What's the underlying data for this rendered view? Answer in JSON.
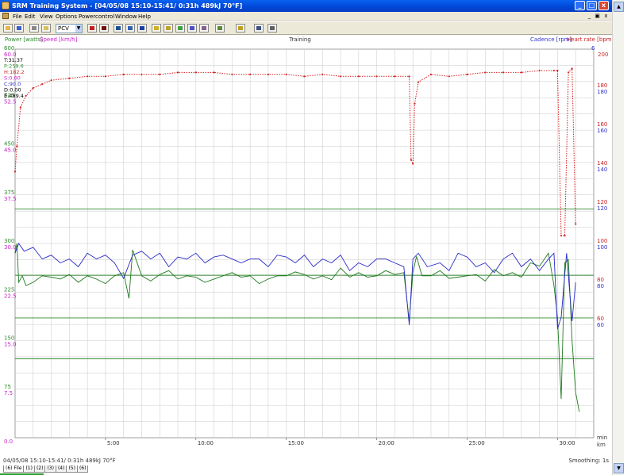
{
  "window": {
    "title": "SRM Training System - [04/05/08 15:10-15:41/ 0:31h 489kJ 70°F]",
    "minimize_label": "_",
    "maximize_label": "□",
    "close_label": "x",
    "mdi_minimize_label": "_",
    "mdi_restore_label": "▣",
    "mdi_close_label": "x"
  },
  "menu": {
    "items": [
      "File",
      "Edit",
      "View",
      "Options",
      "Powercontrol",
      "Window",
      "Help"
    ]
  },
  "toolbar": {
    "combo_value": "PCV",
    "tools": [
      "open-icon",
      "save-icon",
      "print-icon",
      "copy-icon",
      "marker-red-icon",
      "marker-dark-icon",
      "view-split-icon",
      "view-stack-icon",
      "view-panel-icon",
      "graph-icon",
      "graph-multi-icon",
      "graph-line-icon",
      "graph-bar-icon",
      "graph-blank-icon",
      "bar-chart-icon",
      "scatter-icon",
      "info-icon"
    ]
  },
  "chart": {
    "title": "Training",
    "left_legend": [
      "Power [watts]",
      "Speed [km/h]"
    ],
    "right_legend": [
      "Cadence [rpm]",
      "Heart rate [bpm]"
    ],
    "readout": [
      "T:31.37",
      "P:259.6",
      "H:182.2",
      "S:0.00",
      "C:90.0",
      "D:0.00",
      "E:489.4"
    ],
    "readout_colors": [
      "#000000",
      "#2d8b2d",
      "#cc2a2a",
      "#cc22cc",
      "#3333cc",
      "#000000",
      "#000000"
    ],
    "axis_top_left": [
      "600",
      "60.0"
    ],
    "axis_top_right": [
      "6",
      "200"
    ],
    "x_unit_labels": [
      "min",
      "km"
    ],
    "colors": {
      "power": "#1f7a1f",
      "speed": "#cc22cc",
      "cadence": "#2a2ac8",
      "heart_rate": "#d42020",
      "grid": "#c8c8c8",
      "ref_line": "#2d8b2d"
    }
  },
  "chart_data": {
    "type": "line",
    "title": "Training",
    "x": {
      "label": "min",
      "range": [
        0,
        32
      ],
      "ticks": [
        "5:00",
        "10:00",
        "15:00",
        "20:00",
        "25:00",
        "30:00"
      ],
      "tick_values": [
        5,
        10,
        15,
        20,
        25,
        30
      ]
    },
    "y_left_power": {
      "label": "Power [watts]",
      "range": [
        0,
        600
      ],
      "ticks": [
        "75",
        "150",
        "225",
        "300",
        "375",
        "450",
        "525"
      ],
      "tick_values": [
        75,
        150,
        225,
        300,
        375,
        450,
        525
      ]
    },
    "y_left_speed": {
      "label": "Speed [km/h]",
      "range": [
        0,
        60
      ],
      "ticks": [
        "0.0",
        "7.5",
        "15.0",
        "22.5",
        "30.0",
        "37.5",
        "45.0",
        "52.5"
      ],
      "tick_values": [
        0,
        7.5,
        15,
        22.5,
        30,
        37.5,
        45,
        52.5
      ]
    },
    "y_right_cadence": {
      "label": "Cadence [rpm]",
      "range": [
        0,
        200
      ],
      "ticks": [
        "60",
        "80",
        "100",
        "120",
        "140",
        "160",
        "180"
      ],
      "tick_values": [
        60,
        80,
        100,
        120,
        140,
        160,
        180
      ]
    },
    "y_right_hr": {
      "label": "Heart rate [bpm]",
      "range": [
        0,
        200
      ],
      "ticks": [
        "60",
        "80",
        "100",
        "120",
        "140",
        "160",
        "180"
      ],
      "tick_values": [
        60,
        80,
        100,
        120,
        140,
        160,
        180
      ]
    },
    "reference_lines_power": [
      353,
      251,
      185,
      122
    ],
    "series": [
      {
        "name": "Power [watts]",
        "axis": "power",
        "x": [
          0,
          0.1,
          0.2,
          0.4,
          0.6,
          1,
          1.5,
          2,
          2.5,
          3,
          3.5,
          4,
          4.5,
          5,
          5.5,
          6,
          6.3,
          6.5,
          7,
          7.5,
          8,
          8.5,
          9,
          9.5,
          10,
          10.5,
          11,
          11.5,
          12,
          12.5,
          13,
          13.5,
          14,
          14.5,
          15,
          15.5,
          16,
          16.5,
          17,
          17.5,
          18,
          18.5,
          19,
          19.5,
          20,
          20.5,
          21,
          21.5,
          21.8,
          22,
          22.2,
          22.5,
          23,
          23.5,
          24,
          24.5,
          25,
          25.5,
          26,
          26.5,
          27,
          27.5,
          28,
          28.5,
          29,
          29.5,
          29.8,
          30,
          30.2,
          30.4,
          30.6,
          30.8,
          31,
          31.2
        ],
        "values": [
          285,
          300,
          240,
          250,
          235,
          240,
          250,
          248,
          245,
          252,
          240,
          250,
          245,
          238,
          250,
          255,
          215,
          290,
          250,
          242,
          252,
          258,
          245,
          250,
          248,
          240,
          245,
          250,
          255,
          248,
          250,
          238,
          245,
          250,
          250,
          256,
          252,
          245,
          250,
          244,
          262,
          248,
          255,
          248,
          250,
          258,
          252,
          255,
          180,
          255,
          280,
          250,
          250,
          258,
          246,
          248,
          250,
          252,
          242,
          260,
          250,
          255,
          248,
          270,
          265,
          285,
          235,
          185,
          60,
          270,
          275,
          150,
          70,
          40
        ]
      },
      {
        "name": "Cadence [rpm]",
        "axis": "cadence",
        "x": [
          0,
          0.2,
          0.5,
          1,
          1.5,
          2,
          2.5,
          3,
          3.5,
          4,
          4.5,
          5,
          5.5,
          6,
          6.5,
          7,
          7.5,
          8,
          8.5,
          9,
          9.5,
          10,
          10.5,
          11,
          11.5,
          12,
          12.5,
          13,
          13.5,
          14,
          14.5,
          15,
          15.5,
          16,
          16.5,
          17,
          17.5,
          18,
          18.5,
          19,
          19.5,
          20,
          20.5,
          21,
          21.5,
          21.8,
          22,
          22.3,
          22.8,
          23.5,
          24,
          24.5,
          25,
          25.5,
          26,
          26.5,
          27,
          27.5,
          28,
          28.5,
          29,
          29.5,
          29.8,
          30,
          30.2,
          30.5,
          30.8,
          31
        ],
        "values": [
          95,
          100,
          96,
          98,
          92,
          94,
          90,
          92,
          88,
          95,
          92,
          94,
          90,
          82,
          94,
          96,
          92,
          95,
          88,
          93,
          92,
          95,
          90,
          93,
          94,
          92,
          90,
          92,
          92,
          88,
          94,
          93,
          90,
          94,
          88,
          92,
          90,
          94,
          86,
          90,
          88,
          92,
          92,
          90,
          88,
          58,
          92,
          95,
          88,
          90,
          86,
          95,
          93,
          88,
          90,
          85,
          92,
          95,
          88,
          92,
          86,
          92,
          95,
          56,
          62,
          95,
          60,
          80
        ]
      },
      {
        "name": "Heart rate [bpm]",
        "axis": "hr",
        "x": [
          0,
          0.1,
          0.3,
          0.6,
          1,
          1.5,
          2,
          3,
          4,
          5,
          6,
          7,
          8,
          9,
          10,
          11,
          12,
          13,
          14,
          15,
          16,
          17,
          18,
          19,
          20,
          21,
          21.8,
          21.9,
          22,
          22.1,
          22.3,
          23,
          24,
          25,
          26,
          27,
          28,
          29,
          29.8,
          30,
          30.2,
          30.4,
          30.6,
          30.8,
          31
        ],
        "values": [
          137,
          150,
          170,
          176,
          180,
          182,
          184,
          185,
          186,
          186,
          187,
          187,
          187,
          188,
          188,
          188,
          187,
          187,
          187,
          187,
          186,
          187,
          186,
          186,
          186,
          186,
          186,
          143,
          141,
          172,
          183,
          187,
          186,
          187,
          188,
          188,
          188,
          189,
          189,
          189,
          104,
          104,
          188,
          190,
          110
        ]
      }
    ]
  },
  "status": {
    "summary": "04/05/08 15:10-15:41/ 0:31h 489kJ 70°F",
    "smoothing": "Smoothing: 1s",
    "tabs": [
      "(6) File",
      "(1)",
      "(2)",
      "(3)",
      "(4)",
      "(5)",
      "(6)"
    ]
  }
}
